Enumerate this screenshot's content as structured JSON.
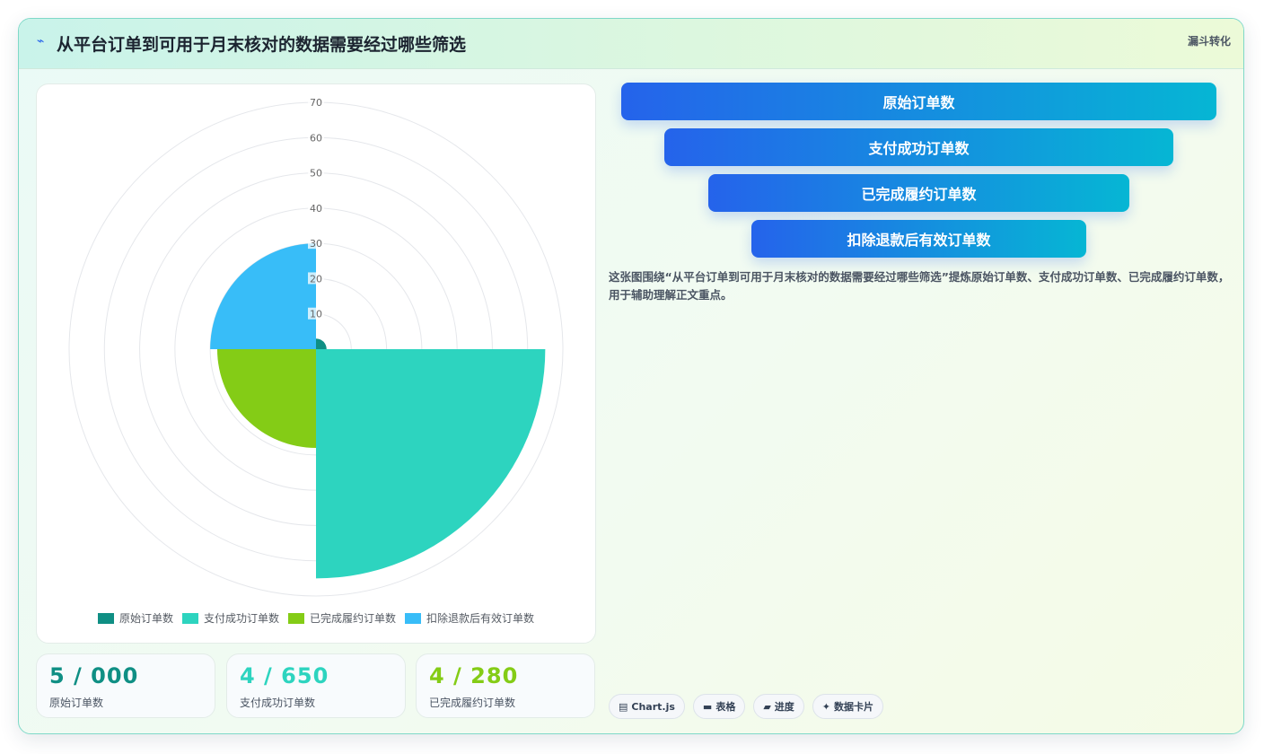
{
  "header": {
    "icon": "zap-icon",
    "title": "从平台订单到可用于月末核对的数据需要经过哪些筛选",
    "tag": "漏斗转化"
  },
  "chart_data": {
    "type": "polarArea",
    "categories": [
      "原始订单数",
      "支付成功订单数",
      "已完成履约订单数",
      "扣除退款后有效订单数"
    ],
    "values": [
      3,
      65,
      28,
      30
    ],
    "colors": [
      "#0f8f84",
      "#2dd4bf",
      "#84cc16",
      "#38bdf8"
    ],
    "radial_ticks": [
      "10",
      "20",
      "30",
      "40",
      "50",
      "60",
      "70"
    ],
    "r_max": 70,
    "legend_position": "bottom",
    "grid": true
  },
  "stats": [
    {
      "value": "5 / 000",
      "label": "原始订单数",
      "color": "#0f8f84"
    },
    {
      "value": "4 / 650",
      "label": "支付成功订单数",
      "color": "#2dd4bf"
    },
    {
      "value": "4 / 280",
      "label": "已完成履约订单数",
      "color": "#84cc16"
    }
  ],
  "funnel": [
    "原始订单数",
    "支付成功订单数",
    "已完成履约订单数",
    "扣除退款后有效订单数"
  ],
  "description": "这张图围绕“从平台订单到可用于月末核对的数据需要经过哪些筛选”提炼原始订单数、支付成功订单数、已完成履约订单数，用于辅助理解正文重点。",
  "chips": [
    {
      "icon": "chart-icon",
      "glyph": "▤",
      "label": "Chart.js"
    },
    {
      "icon": "table-icon",
      "glyph": "▬",
      "label": "表格"
    },
    {
      "icon": "progress-icon",
      "glyph": "▰",
      "label": "进度"
    },
    {
      "icon": "sparkle-icon",
      "glyph": "✦",
      "label": "数据卡片"
    }
  ]
}
